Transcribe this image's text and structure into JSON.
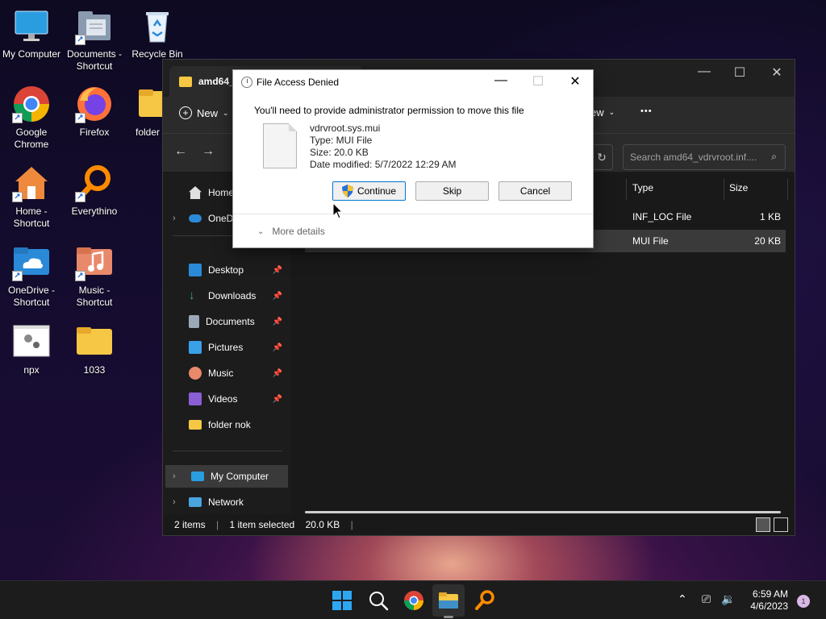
{
  "desktop": {
    "icons": [
      {
        "label": "My Computer"
      },
      {
        "label": "Documents -\nShortcut"
      },
      {
        "label": "Recycle Bin"
      },
      {
        "label": "Google\nChrome"
      },
      {
        "label": "Firefox"
      },
      {
        "label": "folder"
      },
      {
        "label": "Home -\nShortcut"
      },
      {
        "label": "Everythino"
      },
      {
        "label": "OneDrive -\nShortcut"
      },
      {
        "label": "Music -\nShortcut"
      },
      {
        "label": "npx"
      },
      {
        "label": "1033"
      }
    ]
  },
  "explorer": {
    "tab_title": "amd64_",
    "toolbar": {
      "new_label": "New",
      "view_label": "ew",
      "more": "•••"
    },
    "search_placeholder": "Search amd64_vdrvroot.inf....",
    "sidebar": [
      {
        "label": "Home"
      },
      {
        "label": "OneDr"
      },
      {
        "label": "Desktop"
      },
      {
        "label": "Downloads"
      },
      {
        "label": "Documents"
      },
      {
        "label": "Pictures"
      },
      {
        "label": "Music"
      },
      {
        "label": "Videos"
      },
      {
        "label": "folder nok"
      },
      {
        "label": "My Computer"
      },
      {
        "label": "Network"
      }
    ],
    "columns": {
      "type": "Type",
      "size": "Size"
    },
    "rows": [
      {
        "type": "INF_LOC File",
        "size": "1 KB"
      },
      {
        "type": "MUI File",
        "size": "20 KB"
      }
    ],
    "status": {
      "items": "2 items",
      "selected": "1 item selected",
      "size": "20.0 KB"
    }
  },
  "dialog": {
    "title": "File Access Denied",
    "message": "You'll need to provide administrator permission to move this file",
    "file": {
      "name": "vdrvroot.sys.mui",
      "type": "Type: MUI File",
      "size": "Size: 20.0 KB",
      "modified": "Date modified: 5/7/2022 12:29 AM"
    },
    "buttons": {
      "continue": "Continue",
      "skip": "Skip",
      "cancel": "Cancel"
    },
    "more_details": "More details"
  },
  "taskbar": {
    "time": "6:59 AM",
    "date": "4/6/2023",
    "notification_count": "1"
  },
  "colors": {
    "accent": "#0078d4",
    "folder": "#f6c744"
  }
}
